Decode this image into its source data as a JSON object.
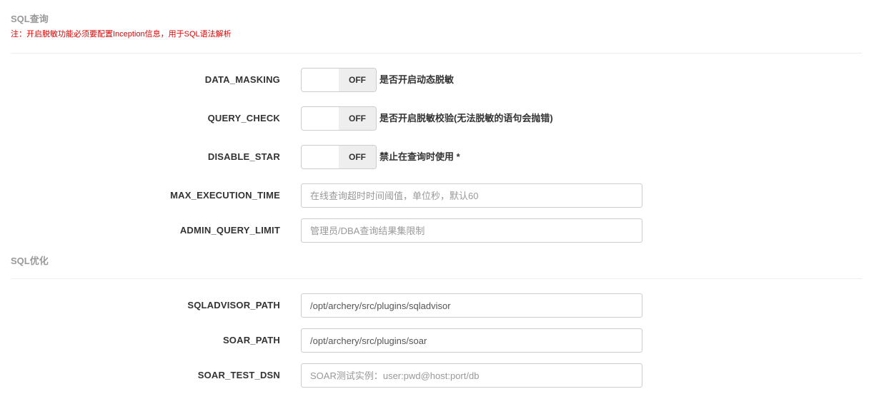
{
  "sections": {
    "query": {
      "title": "SQL查询",
      "note": "注：开启脱敏功能必须要配置Inception信息，用于SQL语法解析",
      "fields": {
        "data_masking": {
          "label": "DATA_MASKING",
          "state": "OFF",
          "description": "是否开启动态脱敏"
        },
        "query_check": {
          "label": "QUERY_CHECK",
          "state": "OFF",
          "description": "是否开启脱敏校验(无法脱敏的语句会抛错)"
        },
        "disable_star": {
          "label": "DISABLE_STAR",
          "state": "OFF",
          "description": "禁止在查询时使用 *"
        },
        "max_execution_time": {
          "label": "MAX_EXECUTION_TIME",
          "value": "",
          "placeholder": "在线查询超时时间阈值，单位秒，默认60"
        },
        "admin_query_limit": {
          "label": "ADMIN_QUERY_LIMIT",
          "value": "",
          "placeholder": "管理员/DBA查询结果集限制"
        }
      }
    },
    "optimize": {
      "title": "SQL优化",
      "fields": {
        "sqladvisor_path": {
          "label": "SQLADVISOR_PATH",
          "value": "/opt/archery/src/plugins/sqladvisor",
          "placeholder": ""
        },
        "soar_path": {
          "label": "SOAR_PATH",
          "value": "/opt/archery/src/plugins/soar",
          "placeholder": ""
        },
        "soar_test_dsn": {
          "label": "SOAR_TEST_DSN",
          "value": "",
          "placeholder": "SOAR测试实例：user:pwd@host:port/db"
        }
      }
    }
  }
}
